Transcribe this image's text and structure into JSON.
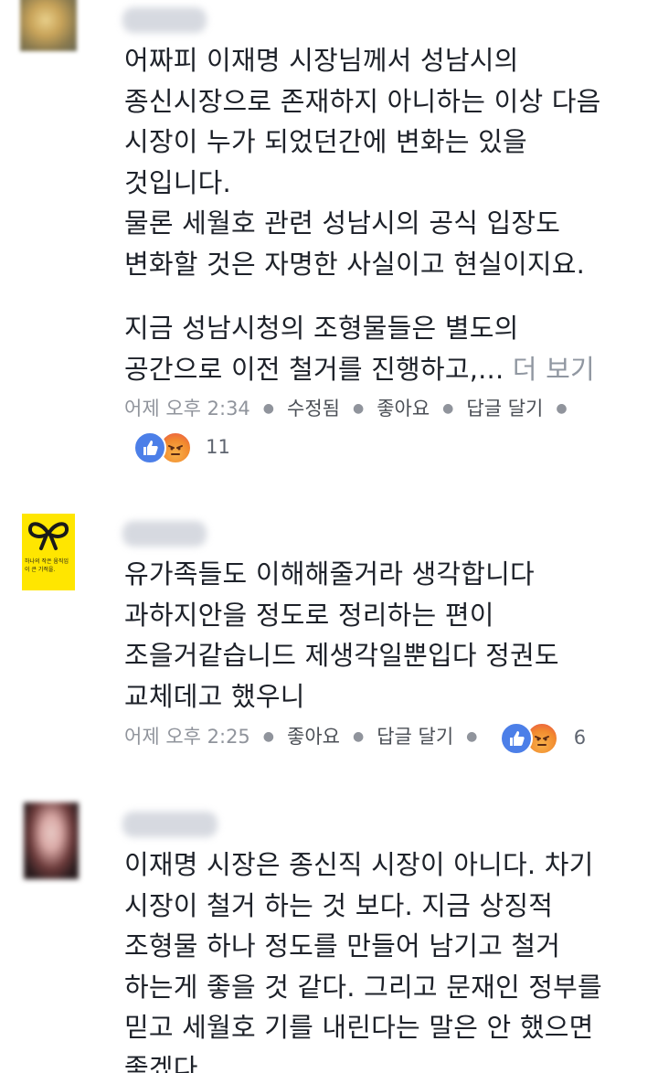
{
  "comments": [
    {
      "lines": [
        "어짜피 이재명 시장님께서 성남시의",
        "종신시장으로 존재하지 아니하는 이상 다음",
        "시장이 누가 되었던간에 변화는 있을",
        "것입니다.",
        "물론 세월호 관련 성남시의 공식 입장도",
        "변화할 것은 자명한 사실이고 현실이지요.",
        "",
        "지금 성남시청의 조형물들은 별도의",
        "공간으로 이전 철거를 진행하고,..."
      ],
      "see_more": "더 보기",
      "time": "어제 오후 2:34",
      "edited": "수정됨",
      "like": "좋아요",
      "reply": "답글 달기",
      "reactions": [
        "like-icon",
        "angry-icon"
      ],
      "reaction_count": "11"
    },
    {
      "avatar_caption": "하나의 작은 움직임이 큰 기적을.",
      "lines": [
        "유가족들도 이해해줄거라 생각합니다",
        "과하지안을 정도로 정리하는 편이",
        "조을거같습니드 제생각일뿐입다 정권도",
        "교체데고 했우니"
      ],
      "time": "어제 오후 2:25",
      "like": "좋아요",
      "reply": "답글 달기",
      "reactions": [
        "like-icon",
        "angry-icon"
      ],
      "reaction_count": "6"
    },
    {
      "lines": [
        "이재명 시장은 종신직 시장이 아니다. 차기",
        "시장이 철거 하는 것 보다. 지금 상징적",
        "조형물 하나 정도를 만들어 남기고 철거",
        "하는게 좋을 것 같다. 그리고 문재인 정부를",
        "믿고 세월호 기를 내린다는 말은 안 했으면",
        "좋겠다."
      ]
    }
  ],
  "colors": {
    "text": "#1d2129",
    "meta": "#90949c",
    "action": "#4b4f56",
    "like_blue": "#4c7fe8",
    "ribbon_yellow": "#ffe600"
  }
}
